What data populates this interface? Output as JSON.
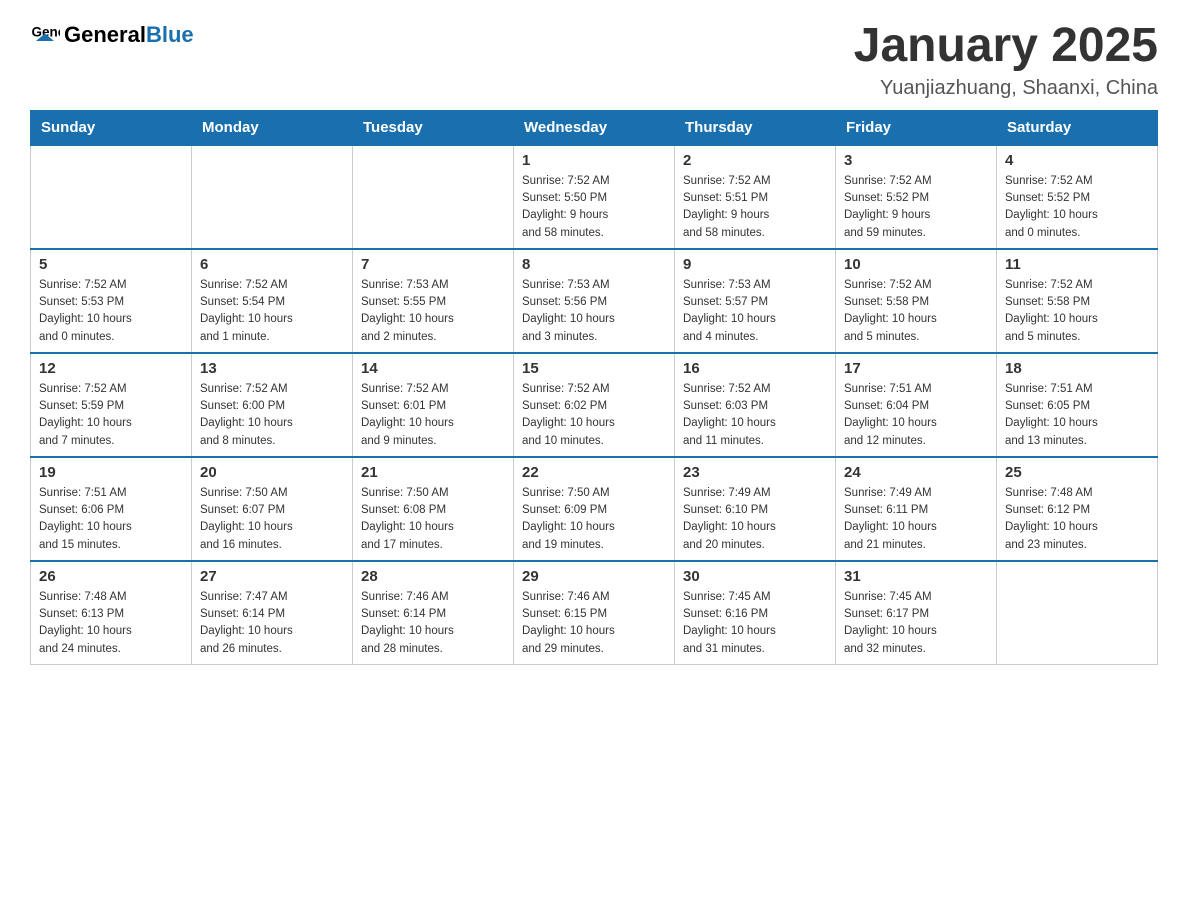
{
  "header": {
    "logo": {
      "general": "General",
      "blue": "Blue"
    },
    "title": "January 2025",
    "location": "Yuanjiazhuang, Shaanxi, China"
  },
  "calendar": {
    "days_of_week": [
      "Sunday",
      "Monday",
      "Tuesday",
      "Wednesday",
      "Thursday",
      "Friday",
      "Saturday"
    ],
    "weeks": [
      {
        "cells": [
          {
            "day": "",
            "info": ""
          },
          {
            "day": "",
            "info": ""
          },
          {
            "day": "",
            "info": ""
          },
          {
            "day": "1",
            "info": "Sunrise: 7:52 AM\nSunset: 5:50 PM\nDaylight: 9 hours\nand 58 minutes."
          },
          {
            "day": "2",
            "info": "Sunrise: 7:52 AM\nSunset: 5:51 PM\nDaylight: 9 hours\nand 58 minutes."
          },
          {
            "day": "3",
            "info": "Sunrise: 7:52 AM\nSunset: 5:52 PM\nDaylight: 9 hours\nand 59 minutes."
          },
          {
            "day": "4",
            "info": "Sunrise: 7:52 AM\nSunset: 5:52 PM\nDaylight: 10 hours\nand 0 minutes."
          }
        ]
      },
      {
        "cells": [
          {
            "day": "5",
            "info": "Sunrise: 7:52 AM\nSunset: 5:53 PM\nDaylight: 10 hours\nand 0 minutes."
          },
          {
            "day": "6",
            "info": "Sunrise: 7:52 AM\nSunset: 5:54 PM\nDaylight: 10 hours\nand 1 minute."
          },
          {
            "day": "7",
            "info": "Sunrise: 7:53 AM\nSunset: 5:55 PM\nDaylight: 10 hours\nand 2 minutes."
          },
          {
            "day": "8",
            "info": "Sunrise: 7:53 AM\nSunset: 5:56 PM\nDaylight: 10 hours\nand 3 minutes."
          },
          {
            "day": "9",
            "info": "Sunrise: 7:53 AM\nSunset: 5:57 PM\nDaylight: 10 hours\nand 4 minutes."
          },
          {
            "day": "10",
            "info": "Sunrise: 7:52 AM\nSunset: 5:58 PM\nDaylight: 10 hours\nand 5 minutes."
          },
          {
            "day": "11",
            "info": "Sunrise: 7:52 AM\nSunset: 5:58 PM\nDaylight: 10 hours\nand 5 minutes."
          }
        ]
      },
      {
        "cells": [
          {
            "day": "12",
            "info": "Sunrise: 7:52 AM\nSunset: 5:59 PM\nDaylight: 10 hours\nand 7 minutes."
          },
          {
            "day": "13",
            "info": "Sunrise: 7:52 AM\nSunset: 6:00 PM\nDaylight: 10 hours\nand 8 minutes."
          },
          {
            "day": "14",
            "info": "Sunrise: 7:52 AM\nSunset: 6:01 PM\nDaylight: 10 hours\nand 9 minutes."
          },
          {
            "day": "15",
            "info": "Sunrise: 7:52 AM\nSunset: 6:02 PM\nDaylight: 10 hours\nand 10 minutes."
          },
          {
            "day": "16",
            "info": "Sunrise: 7:52 AM\nSunset: 6:03 PM\nDaylight: 10 hours\nand 11 minutes."
          },
          {
            "day": "17",
            "info": "Sunrise: 7:51 AM\nSunset: 6:04 PM\nDaylight: 10 hours\nand 12 minutes."
          },
          {
            "day": "18",
            "info": "Sunrise: 7:51 AM\nSunset: 6:05 PM\nDaylight: 10 hours\nand 13 minutes."
          }
        ]
      },
      {
        "cells": [
          {
            "day": "19",
            "info": "Sunrise: 7:51 AM\nSunset: 6:06 PM\nDaylight: 10 hours\nand 15 minutes."
          },
          {
            "day": "20",
            "info": "Sunrise: 7:50 AM\nSunset: 6:07 PM\nDaylight: 10 hours\nand 16 minutes."
          },
          {
            "day": "21",
            "info": "Sunrise: 7:50 AM\nSunset: 6:08 PM\nDaylight: 10 hours\nand 17 minutes."
          },
          {
            "day": "22",
            "info": "Sunrise: 7:50 AM\nSunset: 6:09 PM\nDaylight: 10 hours\nand 19 minutes."
          },
          {
            "day": "23",
            "info": "Sunrise: 7:49 AM\nSunset: 6:10 PM\nDaylight: 10 hours\nand 20 minutes."
          },
          {
            "day": "24",
            "info": "Sunrise: 7:49 AM\nSunset: 6:11 PM\nDaylight: 10 hours\nand 21 minutes."
          },
          {
            "day": "25",
            "info": "Sunrise: 7:48 AM\nSunset: 6:12 PM\nDaylight: 10 hours\nand 23 minutes."
          }
        ]
      },
      {
        "cells": [
          {
            "day": "26",
            "info": "Sunrise: 7:48 AM\nSunset: 6:13 PM\nDaylight: 10 hours\nand 24 minutes."
          },
          {
            "day": "27",
            "info": "Sunrise: 7:47 AM\nSunset: 6:14 PM\nDaylight: 10 hours\nand 26 minutes."
          },
          {
            "day": "28",
            "info": "Sunrise: 7:46 AM\nSunset: 6:14 PM\nDaylight: 10 hours\nand 28 minutes."
          },
          {
            "day": "29",
            "info": "Sunrise: 7:46 AM\nSunset: 6:15 PM\nDaylight: 10 hours\nand 29 minutes."
          },
          {
            "day": "30",
            "info": "Sunrise: 7:45 AM\nSunset: 6:16 PM\nDaylight: 10 hours\nand 31 minutes."
          },
          {
            "day": "31",
            "info": "Sunrise: 7:45 AM\nSunset: 6:17 PM\nDaylight: 10 hours\nand 32 minutes."
          },
          {
            "day": "",
            "info": ""
          }
        ]
      }
    ]
  }
}
